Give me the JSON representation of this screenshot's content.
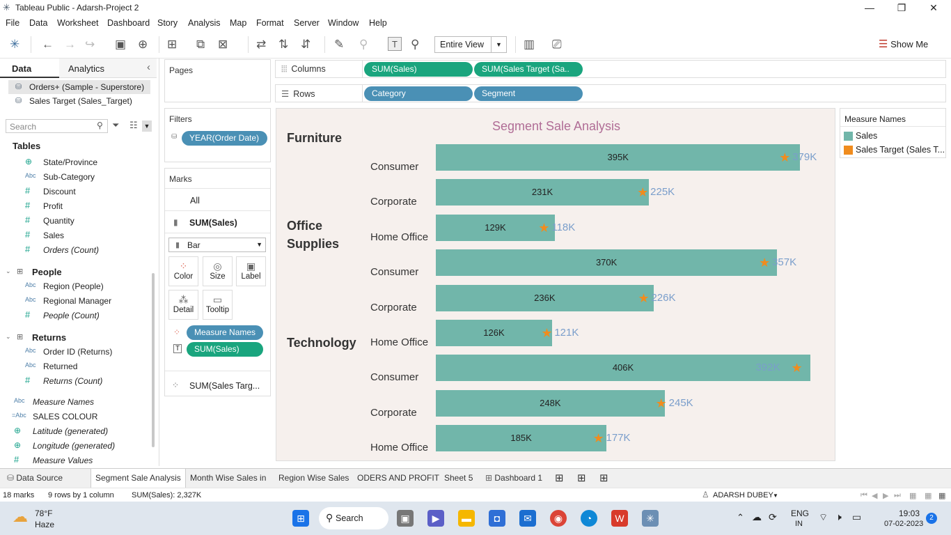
{
  "window": {
    "title": "Tableau Public - Adarsh-Project 2"
  },
  "menu": [
    "File",
    "Data",
    "Worksheet",
    "Dashboard",
    "Story",
    "Analysis",
    "Map",
    "Format",
    "Server",
    "Window",
    "Help"
  ],
  "toolbar": {
    "view_select": "Entire View",
    "show_me": "Show Me"
  },
  "leftpanel": {
    "tab_data": "Data",
    "tab_analytics": "Analytics",
    "datasources": [
      "Orders+ (Sample - Superstore)",
      "Sales Target (Sales_Target)"
    ],
    "search_placeholder": "Search",
    "tables_heading": "Tables",
    "fields_top": [
      {
        "type": "glb",
        "name": "State/Province",
        "it": false
      },
      {
        "type": "Abc",
        "name": "Sub-Category",
        "it": false
      },
      {
        "type": "#",
        "name": "Discount",
        "it": false
      },
      {
        "type": "#",
        "name": "Profit",
        "it": false
      },
      {
        "type": "#",
        "name": "Quantity",
        "it": false
      },
      {
        "type": "#",
        "name": "Sales",
        "it": false
      },
      {
        "type": "#",
        "name": "Orders (Count)",
        "it": true
      }
    ],
    "folder_people": "People",
    "fields_people": [
      {
        "type": "Abc",
        "name": "Region (People)",
        "it": false
      },
      {
        "type": "Abc",
        "name": "Regional Manager",
        "it": false
      },
      {
        "type": "#",
        "name": "People (Count)",
        "it": true
      }
    ],
    "folder_returns": "Returns",
    "fields_returns": [
      {
        "type": "Abc",
        "name": "Order ID (Returns)",
        "it": false
      },
      {
        "type": "Abc",
        "name": "Returned",
        "it": false
      },
      {
        "type": "#",
        "name": "Returns (Count)",
        "it": true
      }
    ],
    "fields_bottom": [
      {
        "type": "Abc",
        "name": "Measure Names",
        "it": true
      },
      {
        "type": "=Abc",
        "name": "SALES COLOUR",
        "it": false
      },
      {
        "type": "glb",
        "name": "Latitude (generated)",
        "it": true
      },
      {
        "type": "glb",
        "name": "Longitude (generated)",
        "it": true
      },
      {
        "type": "#",
        "name": "Measure Values",
        "it": true
      }
    ]
  },
  "cards": {
    "pages": "Pages",
    "filters": "Filters",
    "filter_pill": "YEAR(Order Date)",
    "marks": "Marks",
    "marks_all": "All",
    "marks_sum_sales": "SUM(Sales)",
    "mark_type": "Bar",
    "buttons": [
      "Color",
      "Size",
      "Label",
      "Detail",
      "Tooltip"
    ],
    "mark_pill_1": "Measure Names",
    "mark_pill_2": "SUM(Sales)",
    "marks_target": "SUM(Sales Targ..."
  },
  "shelves": {
    "columns_label": "Columns",
    "columns": [
      "SUM(Sales)",
      "SUM(Sales Target (Sa.."
    ],
    "rows_label": "Rows",
    "rows": [
      "Category",
      "Segment"
    ]
  },
  "legend": {
    "title": "Measure Names",
    "items": [
      {
        "label": "Sales",
        "color": "#71b6aa"
      },
      {
        "label": "Sales Target (Sales T...",
        "color": "#f08c1e"
      }
    ]
  },
  "chart_data": {
    "type": "bar",
    "title": "Segment Sale Analysis",
    "orientation": "horizontal",
    "categories": [
      "Furniture",
      "Office Supplies",
      "Technology"
    ],
    "segments": [
      "Consumer",
      "Corporate",
      "Home Office"
    ],
    "xlim": [
      0,
      420
    ],
    "series": [
      {
        "name": "Sales",
        "unit": "K",
        "values": [
          395,
          231,
          129,
          370,
          236,
          126,
          406,
          248,
          185
        ]
      },
      {
        "name": "Sales Target (Sales T...",
        "unit": "K",
        "values": [
          379,
          225,
          118,
          357,
          226,
          121,
          392,
          245,
          177
        ]
      }
    ],
    "rows": [
      {
        "category": "Furniture",
        "segment": "Consumer",
        "sales": 395,
        "target": 379
      },
      {
        "category": "Furniture",
        "segment": "Corporate",
        "sales": 231,
        "target": 225
      },
      {
        "category": "Furniture",
        "segment": "Home Office",
        "sales": 129,
        "target": 118
      },
      {
        "category": "Office Supplies",
        "segment": "Consumer",
        "sales": 370,
        "target": 357
      },
      {
        "category": "Office Supplies",
        "segment": "Corporate",
        "sales": 236,
        "target": 226
      },
      {
        "category": "Office Supplies",
        "segment": "Home Office",
        "sales": 126,
        "target": 121
      },
      {
        "category": "Technology",
        "segment": "Consumer",
        "sales": 406,
        "target": 392
      },
      {
        "category": "Technology",
        "segment": "Corporate",
        "sales": 248,
        "target": 245
      },
      {
        "category": "Technology",
        "segment": "Home Office",
        "sales": 185,
        "target": 177
      }
    ],
    "colors": {
      "sales": "#71b6aa",
      "target": "#f08c1e",
      "target_label": "#7a9ecb"
    }
  },
  "tabs": [
    "Data Source",
    "Segment Sale Analysis",
    "Month Wise Sales in",
    "Region Wise Sales",
    "ODERS AND PROFIT",
    "Sheet 5",
    "Dashboard 1"
  ],
  "status": {
    "marks": "18 marks",
    "rows": "9 rows by 1 column",
    "sum": "SUM(Sales): 2,327K",
    "user": "ADARSH DUBEY"
  },
  "taskbar": {
    "temp": "78°F",
    "weather": "Haze",
    "search": "Search",
    "lang1": "ENG",
    "lang2": "IN",
    "time": "19:03",
    "date": "07-02-2023",
    "notif": "2"
  }
}
